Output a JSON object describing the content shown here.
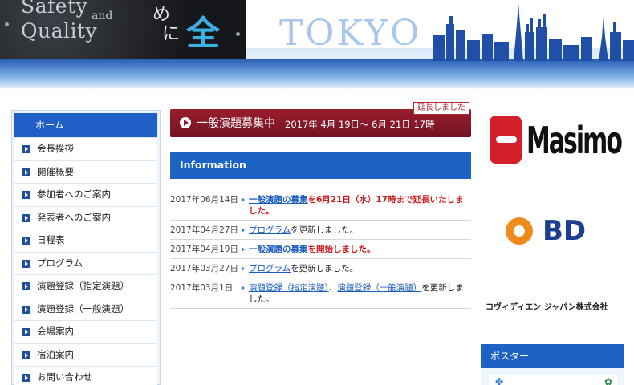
{
  "header": {
    "hero_en_line1": "Safety",
    "hero_en_and": "and",
    "hero_en_line2": "Quality",
    "hero_jp_line1": "め",
    "hero_jp_line2": "に",
    "hero_jp_big": "全",
    "city": "TOKYO"
  },
  "sidebar": {
    "home": "ホーム",
    "items": [
      "会長挨拶",
      "開催概要",
      "参加者へのご案内",
      "発表者へのご案内",
      "日程表",
      "プログラム",
      "演題登録（指定演題）",
      "演題登録（一般演題）",
      "会場案内",
      "宿泊案内",
      "お問い合わせ"
    ]
  },
  "banner": {
    "tag": "延長しました",
    "title": "一般演題募集中",
    "period": "2017年 4月 19日〜 6月 21日 17時"
  },
  "information": {
    "heading": "Information",
    "rows": [
      {
        "date": "2017年06月14日",
        "link": "一般演題の募集",
        "rest": "を6月21日（水）17時まで延長いたしました。"
      },
      {
        "date": "2017年04月27日",
        "link": "プログラム",
        "rest": "を更新しました。"
      },
      {
        "date": "2017年04月19日",
        "link": "一般演題の募集",
        "rest": "を開始しました。"
      },
      {
        "date": "2017年03月27日",
        "link": "プログラム",
        "rest": "を更新しました。"
      },
      {
        "date": "2017年03月1日",
        "link": "演題登録（指定演題）",
        "mid": "、",
        "link2": "演題登録（一般演題）",
        "rest": "を更新しました。"
      }
    ]
  },
  "sponsors": {
    "masimo": "Masimo",
    "bd": "BD",
    "covidien": "コヴィディエン ジャパン株式会社"
  },
  "poster": {
    "heading": "ポスター"
  }
}
